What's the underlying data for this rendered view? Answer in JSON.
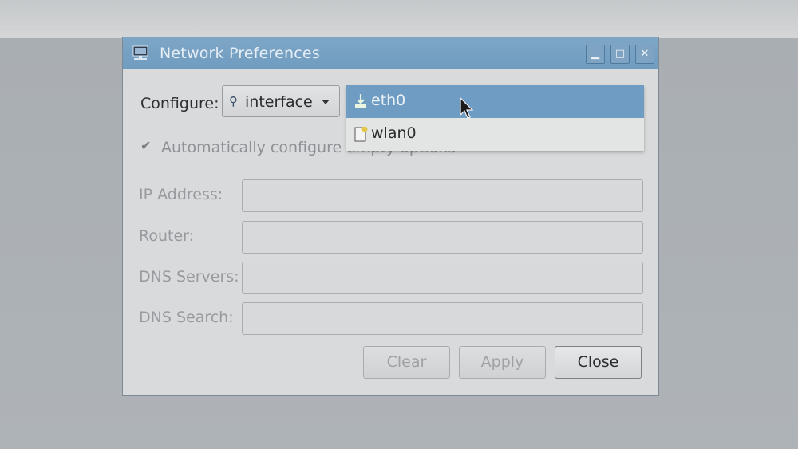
{
  "window": {
    "title": "Network Preferences",
    "buttons": {
      "minimize": "▁",
      "maximize": "□",
      "close": "✕"
    }
  },
  "configure": {
    "label": "Configure:",
    "type_value": "interface",
    "type_icon": "network-interface-icon"
  },
  "dropdown": {
    "items": [
      {
        "label": "eth0",
        "icon": "ethernet-icon",
        "selected": true
      },
      {
        "label": "wlan0",
        "icon": "wireless-icon",
        "selected": false
      }
    ]
  },
  "auto_configure": {
    "label": "Automatically configure empty options",
    "checked": true
  },
  "fields": {
    "ip_address": {
      "label": "IP Address:",
      "value": ""
    },
    "router": {
      "label": "Router:",
      "value": ""
    },
    "dns_servers": {
      "label": "DNS Servers:",
      "value": ""
    },
    "dns_search": {
      "label": "DNS Search:",
      "value": ""
    }
  },
  "actions": {
    "clear": "Clear",
    "apply": "Apply",
    "close": "Close"
  },
  "colors": {
    "titlebar": "#6f9cc0",
    "selection": "#6e9cc2",
    "window_bg": "#d8dadb"
  }
}
